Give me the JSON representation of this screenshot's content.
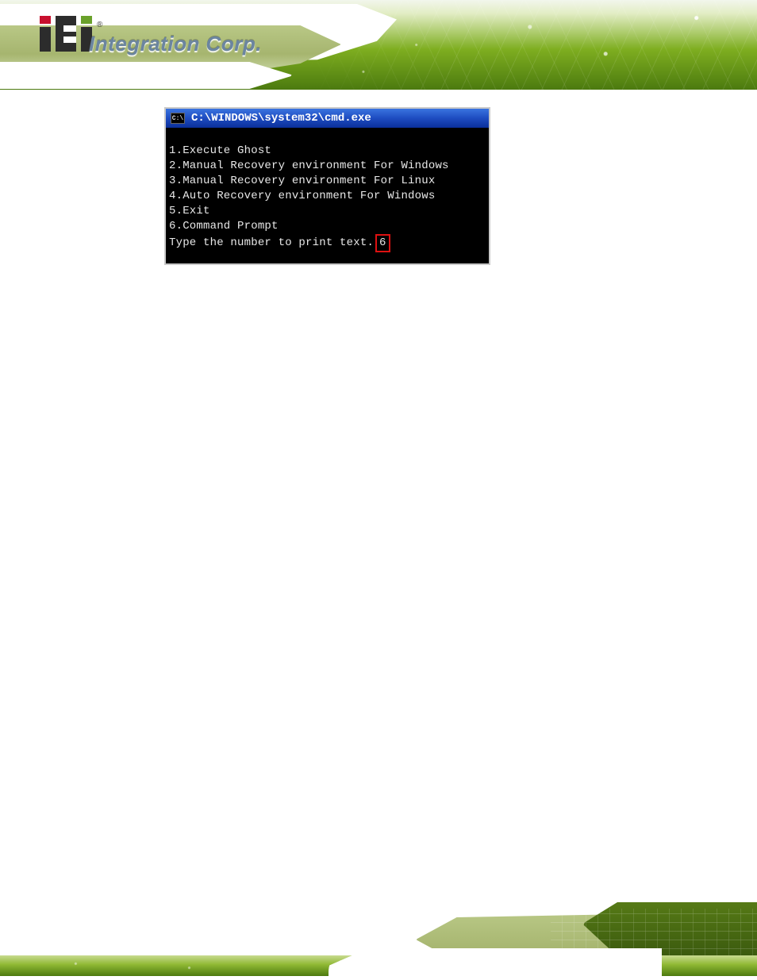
{
  "brand": {
    "logo_alt": "iEi",
    "tagline": "Integration Corp.",
    "registered": "®"
  },
  "cmd": {
    "icon_label": "C:\\",
    "title": "C:\\WINDOWS\\system32\\cmd.exe",
    "menu": [
      "1.Execute Ghost",
      "2.Manual Recovery environment For Windows",
      "3.Manual Recovery environment For Linux",
      "4.Auto Recovery environment For Windows",
      "5.Exit",
      "6.Command Prompt"
    ],
    "prompt": "Type the number to print text.",
    "input_value": "6"
  }
}
